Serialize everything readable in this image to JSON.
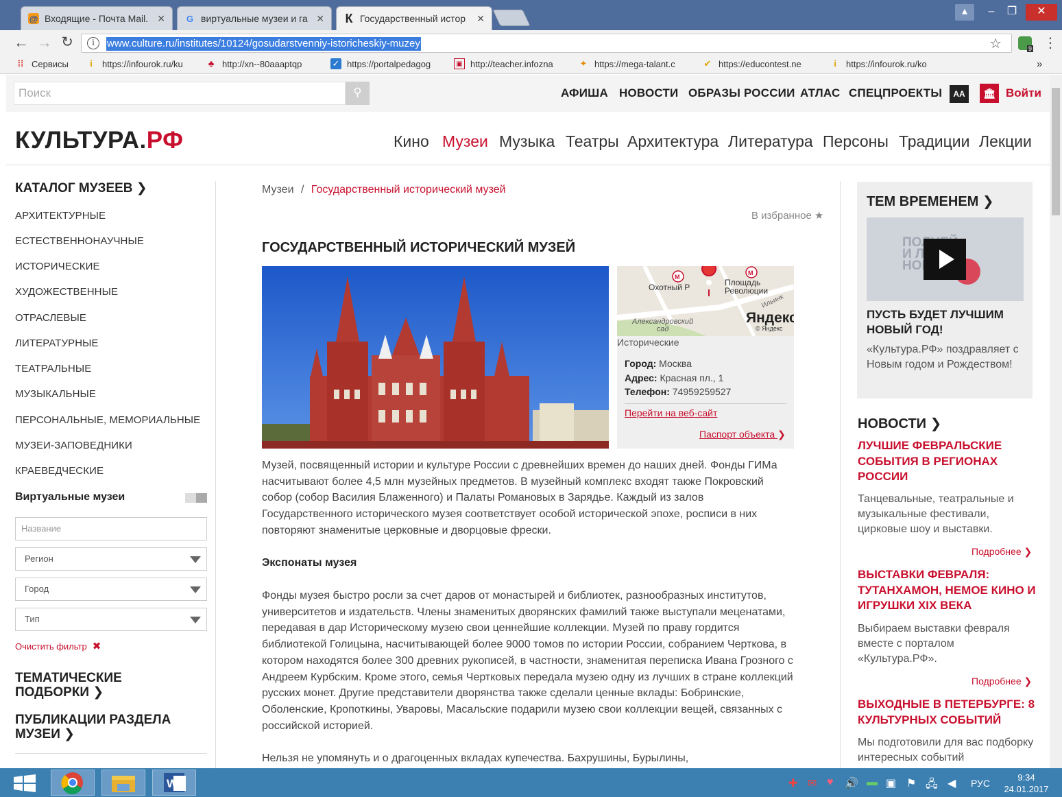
{
  "browser": {
    "tabs": [
      {
        "title": "Входящие - Почта Mail.",
        "icon": "mail-icon"
      },
      {
        "title": "виртуальные музеи и га",
        "icon": "google-icon"
      },
      {
        "title": "Государственный истор",
        "icon": "kultura-icon"
      }
    ],
    "url": "www.culture.ru/institutes/10124/gosudarstvenniy-istoricheskiy-muzey",
    "extension_badge": "9",
    "bookmarks": [
      "Сервисы",
      "https://infourok.ru/ku",
      "http://xn--80aaaptqp",
      "https://portalpedagog",
      "http://teacher.infozna",
      "https://mega-talant.c",
      "https://educontest.ne",
      "https://infourok.ru/ko"
    ],
    "more_bookmarks": "»"
  },
  "site": {
    "search_placeholder": "Поиск",
    "top_nav": [
      "АФИША",
      "НОВОСТИ",
      "ОБРАЗЫ РОССИИ",
      "АТЛАС",
      "СПЕЦПРОЕКТЫ"
    ],
    "aa_label": "АА",
    "login_label": "Войти",
    "logo_main": "КУЛЬТУРА.",
    "logo_rf": "РФ",
    "main_nav": [
      "Кино",
      "Музеи",
      "Музыка",
      "Театры",
      "Архитектура",
      "Литература",
      "Персоны",
      "Традиции",
      "Лекции"
    ],
    "main_nav_active": "Музеи"
  },
  "sidebar": {
    "catalog_title": "КАТАЛОГ МУЗЕЕВ ❯",
    "categories": [
      "АРХИТЕКТУРНЫЕ",
      "ЕСТЕСТВЕННОНАУЧНЫЕ",
      "ИСТОРИЧЕСКИЕ",
      "ХУДОЖЕСТВЕННЫЕ",
      "ОТРАСЛЕВЫЕ",
      "ЛИТЕРАТУРНЫЕ",
      "ТЕАТРАЛЬНЫЕ",
      "МУЗЫКАЛЬНЫЕ",
      "ПЕРСОНАЛЬНЫЕ, МЕМОРИАЛЬНЫЕ",
      "МУЗЕИ-ЗАПОВЕДНИКИ",
      "КРАЕВЕДЧЕСКИЕ"
    ],
    "virtual_label": "Виртуальные музеи",
    "name_placeholder": "Название",
    "region": "Регион",
    "city": "Город",
    "type": "Тип",
    "clear_filter": "Очистить фильтр",
    "thematic": [
      "ТЕМАТИЧЕСКИЕ",
      "ПОДБОРКИ ❯"
    ],
    "publications": [
      "ПУБЛИКАЦИИ РАЗДЕЛА",
      "МУЗЕИ ❯"
    ]
  },
  "content": {
    "breadcrumb_root": "Музеи",
    "breadcrumb_sep": "/",
    "breadcrumb_current": "Государственный исторический музей",
    "favorite": "В избранное ★",
    "title": "ГОСУДАРСТВЕННЫЙ ИСТОРИЧЕСКИЙ МУЗЕЙ",
    "map_labels": {
      "metro1": "Охотный Р",
      "metro2": "Площадь\nРеволюции",
      "park": "Александровский\nсад",
      "street": "Ильинк",
      "yandex": "Яндекс",
      "copyright": "© Яндекс"
    },
    "card_category": "Исторические",
    "city_label": "Город:",
    "city_value": "Москва",
    "address_label": "Адрес:",
    "address_value": "Красная пл., 1",
    "phone_label": "Телефон:",
    "phone_value": "74959259527",
    "website_link": "Перейти на веб-сайт",
    "passport_link": "Паспорт объекта",
    "intro": "Музей, посвященный истории и культуре России с древнейших времен до наших дней. Фонды ГИМа насчитывают более 4,5 млн музейных предметов. В музейный комплекс входят также Покровский собор (собор Василия Блаженного) и Палаты Романовых в Зарядье. Каждый из залов Государственного исторического музея соответствует особой исторической эпохе, росписи в них повторяют знаменитые церковные и дворцовые фрески.",
    "exhibits_heading": "Экспонаты музея",
    "exhibits_text": "Фонды музея быстро росли за счет даров от монастырей и библиотек, разнообразных институтов, университетов и издательств. Члены знаменитых дворянских фамилий также выступали меценатами, передавая в дар Историческому музею свои ценнейшие коллекции. Музей по праву гордится библиотекой Голицына, насчитывающей более 9000 томов по истории России, собранием Черткова, в котором находятся более 300 древних рукописей, в частности, знаменитая переписка Ивана Грозного с Андреем Курбским. Кроме этого, семья Чертковых передала музею одну из лучших в стране коллекций русских монет. Другие представители дворянства также сделали ценные вклады: Бобринские, Оболенские, Кропоткины, Уваровы, Масальские подарили музею свои коллекции вещей, связанных с российской историей.",
    "merchants_text": "Нельзя не упомянуть и о драгоценных вкладах купечества. Бахрушины, Бурылины,"
  },
  "right": {
    "promo_heading": "ТЕМ ВРЕМЕНЕМ ❯",
    "video_overlay": "ПОЛНЕЙ И ЛУ НОВЫЙ",
    "promo_title": "ПУСТЬ БУДЕТ ЛУЧШИМ НОВЫЙ ГОД!",
    "promo_text": "«Культура.РФ» поздравляет с Новым годом и Рождеством!",
    "news_heading": "НОВОСТИ ❯",
    "news": [
      {
        "title": "ЛУЧШИЕ ФЕВРАЛЬСКИЕ СОБЫТИЯ В РЕГИОНАХ РОССИИ",
        "text": "Танцевальные, театральные и музыкальные фестивали, цирковые шоу и выставки.",
        "more": "Подробнее ❯"
      },
      {
        "title": "ВЫСТАВКИ ФЕВРАЛЯ: ТУТАНХАМОН, НЕМОЕ КИНО И ИГРУШКИ XIX ВЕКА",
        "text": "Выбираем выставки февраля вместе с порталом «Культура.РФ».",
        "more": "Подробнее ❯"
      },
      {
        "title": "ВЫХОДНЫЕ В ПЕТЕРБУРГЕ: 8 КУЛЬТУРНЫХ СОБЫТИЙ",
        "text": "Мы подготовили для вас подборку интересных событий"
      }
    ]
  },
  "taskbar": {
    "lang": "РУС",
    "time": "9:34",
    "date": "24.01.2017"
  },
  "colors": {
    "accent": "#c8102e",
    "taskbar": "#3c7fb1",
    "tabstrip": "#4e6c9c"
  }
}
